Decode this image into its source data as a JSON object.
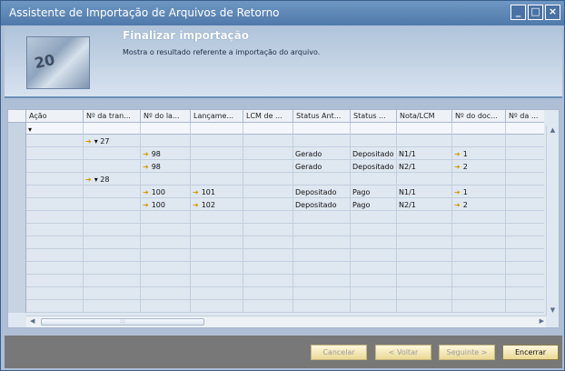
{
  "window": {
    "title": "Assistente de Importação de Arquivos de Retorno",
    "controls": [
      "_",
      "□",
      "×"
    ]
  },
  "header": {
    "title": "Finalizar importação",
    "subtitle": "Mostra o resultado referente a importação do arquivo.",
    "image_text": "20"
  },
  "table": {
    "columns": [
      "Ação",
      "Nº da tran...",
      "Nº do la...",
      "Lançame...",
      "LCM de ...",
      "Status Ant...",
      "Status ...",
      "Nota/LCM",
      "Nº do doc...",
      "Nº da ..."
    ],
    "rows": [
      [
        "",
        "",
        "",
        "",
        "",
        "",
        "",
        "",
        "",
        ""
      ],
      [
        "",
        "▾ 27",
        "",
        "",
        "",
        "",
        "",
        "",
        "",
        ""
      ],
      [
        "",
        "",
        "98",
        "",
        "",
        "Gerado",
        "Depositado",
        "N1/1",
        "1",
        ""
      ],
      [
        "",
        "",
        "98",
        "",
        "",
        "Gerado",
        "Depositado",
        "N2/1",
        "2",
        ""
      ],
      [
        "",
        "▾ 28",
        "",
        "",
        "",
        "",
        "",
        "",
        "",
        ""
      ],
      [
        "",
        "",
        "100",
        "101",
        "",
        "Depositado",
        "Pago",
        "N1/1",
        "1",
        ""
      ],
      [
        "",
        "",
        "100",
        "102",
        "",
        "Depositado",
        "Pago",
        "N2/1",
        "2",
        ""
      ]
    ]
  },
  "buttons": {
    "cancel": "Cancelar",
    "back": "< Voltar",
    "next": "Seguinte >",
    "finish": "Encerrar"
  }
}
